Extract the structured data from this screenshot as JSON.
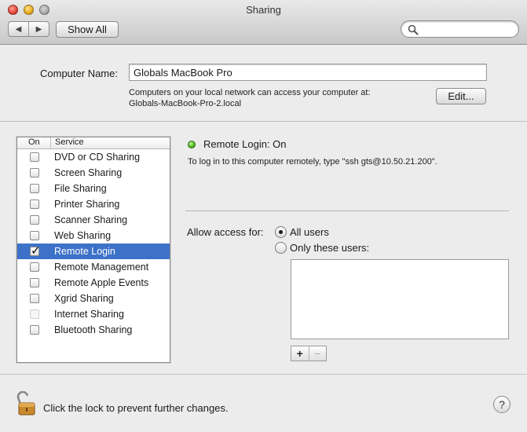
{
  "window": {
    "title": "Sharing"
  },
  "toolbar": {
    "show_all": "Show All",
    "search_placeholder": ""
  },
  "computer": {
    "label": "Computer Name:",
    "name": "Globals MacBook Pro",
    "info_line1": "Computers on your local network can access your computer at:",
    "info_line2": "Globals-MacBook-Pro-2.local",
    "edit_label": "Edit..."
  },
  "services": {
    "header_on": "On",
    "header_service": "Service",
    "items": [
      {
        "name": "DVD or CD Sharing",
        "checked": false,
        "enabled": true,
        "selected": false
      },
      {
        "name": "Screen Sharing",
        "checked": false,
        "enabled": true,
        "selected": false
      },
      {
        "name": "File Sharing",
        "checked": false,
        "enabled": true,
        "selected": false
      },
      {
        "name": "Printer Sharing",
        "checked": false,
        "enabled": true,
        "selected": false
      },
      {
        "name": "Scanner Sharing",
        "checked": false,
        "enabled": true,
        "selected": false
      },
      {
        "name": "Web Sharing",
        "checked": false,
        "enabled": true,
        "selected": false
      },
      {
        "name": "Remote Login",
        "checked": true,
        "enabled": true,
        "selected": true
      },
      {
        "name": "Remote Management",
        "checked": false,
        "enabled": true,
        "selected": false
      },
      {
        "name": "Remote Apple Events",
        "checked": false,
        "enabled": true,
        "selected": false
      },
      {
        "name": "Xgrid Sharing",
        "checked": false,
        "enabled": true,
        "selected": false
      },
      {
        "name": "Internet Sharing",
        "checked": false,
        "enabled": false,
        "selected": false
      },
      {
        "name": "Bluetooth Sharing",
        "checked": false,
        "enabled": true,
        "selected": false
      }
    ]
  },
  "detail": {
    "status": "Remote Login: On",
    "status_color": "#46b51b",
    "instructions": "To log in to this computer remotely, type \"ssh gts@10.50.21.200\".",
    "access_label": "Allow access for:",
    "option_all": "All users",
    "option_these": "Only these users:",
    "selected_option": "all",
    "add": "+",
    "remove": "−"
  },
  "footer": {
    "lock_text": "Click the lock to prevent further changes.",
    "help": "?"
  }
}
